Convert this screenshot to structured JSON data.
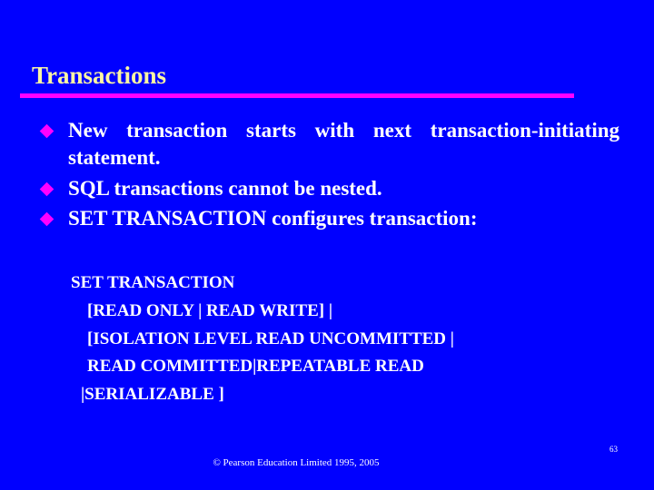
{
  "slide": {
    "title": "Transactions",
    "accent_color": "#ff00ff",
    "background_color": "#0000ff",
    "title_color": "#fbf5a3",
    "body_color": "#ffffff",
    "bullets": [
      {
        "marker": "diamond-bullet",
        "text": "New transaction starts with next transaction-initiating statement."
      },
      {
        "marker": "diamond-bullet",
        "text": "SQL transactions cannot be nested."
      },
      {
        "marker": "diamond-bullet",
        "text": "SET TRANSACTION configures transaction:"
      }
    ],
    "syntax": [
      "SET TRANSACTION",
      "[READ ONLY | READ WRITE] |",
      "[ISOLATION LEVEL READ UNCOMMITTED |",
      "READ COMMITTED|REPEATABLE READ",
      "|SERIALIZABLE ]"
    ],
    "footer": {
      "copyright": "© Pearson Education Limited 1995, 2005",
      "page_number": "63"
    }
  }
}
